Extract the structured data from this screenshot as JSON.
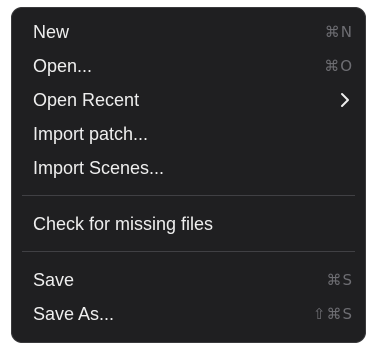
{
  "menu": {
    "items": [
      {
        "label": "New",
        "shortcut": "⌘N"
      },
      {
        "label": "Open...",
        "shortcut": "⌘O"
      },
      {
        "label": "Open Recent",
        "submenu_icon": "chevron-right-icon"
      },
      {
        "label": "Import patch..."
      },
      {
        "label": "Import Scenes..."
      },
      {
        "label": "Check for missing files"
      },
      {
        "label": "Save",
        "shortcut": "⌘S"
      },
      {
        "label": "Save As...",
        "shortcut": "⇧⌘S"
      }
    ]
  },
  "colors": {
    "menu_background": "#1f1f21",
    "label_text": "#eeeeee",
    "shortcut_text": "#6d6d72",
    "separator": "#404044"
  }
}
